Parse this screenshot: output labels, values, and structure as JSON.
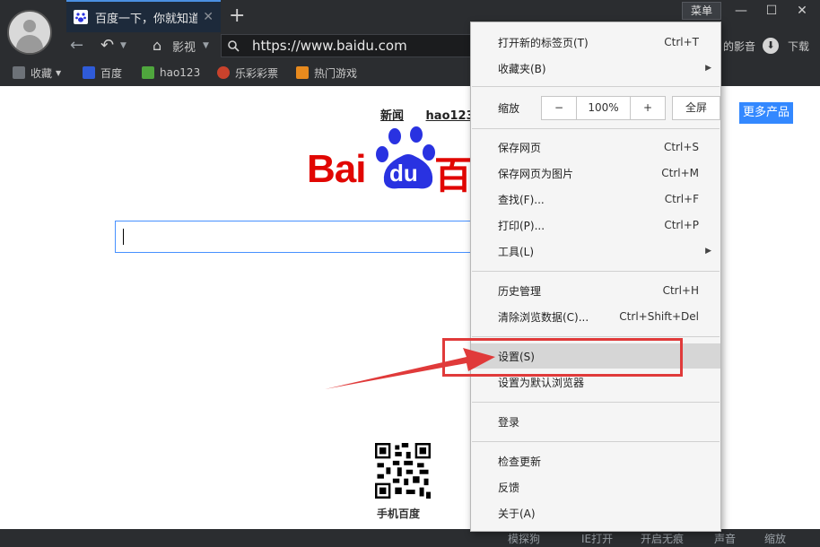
{
  "tab": {
    "title": "百度一下，你就知道",
    "close": "✕"
  },
  "new_tab": "+",
  "window": {
    "menu_label": "菜单",
    "minimize": "—",
    "maximize": "☐",
    "close": "✕"
  },
  "nav": {
    "home_label": "影视",
    "url": "https://www.baidu.com",
    "right_partial": "的影音",
    "download": "下载"
  },
  "bookmarks": [
    {
      "label": "收藏",
      "icon": "star-icon"
    },
    {
      "label": "百度",
      "icon": "baidu-icon"
    },
    {
      "label": "hao123",
      "icon": "hao123-icon"
    },
    {
      "label": "乐彩彩票",
      "icon": "lottery-icon"
    },
    {
      "label": "热门游戏",
      "icon": "game-icon"
    }
  ],
  "page": {
    "toplinks": [
      "新闻",
      "hao123"
    ],
    "more_products": "更多产品",
    "logo_text_left": "Bai",
    "logo_text_du": "du",
    "logo_text_right": "百",
    "qr_label": "手机百度"
  },
  "menu": {
    "items_group1": [
      {
        "label": "打开新的标签页(T)",
        "shortcut": "Ctrl+T",
        "submenu": false
      },
      {
        "label": "收藏夹(B)",
        "shortcut": "",
        "submenu": true
      }
    ],
    "zoom": {
      "label": "缩放",
      "minus": "−",
      "value": "100%",
      "plus": "+",
      "fullscreen": "全屏"
    },
    "items_group2": [
      {
        "label": "保存网页",
        "shortcut": "Ctrl+S",
        "submenu": false
      },
      {
        "label": "保存网页为图片",
        "shortcut": "Ctrl+M",
        "submenu": false
      },
      {
        "label": "查找(F)...",
        "shortcut": "Ctrl+F",
        "submenu": false
      },
      {
        "label": "打印(P)...",
        "shortcut": "Ctrl+P",
        "submenu": false
      },
      {
        "label": "工具(L)",
        "shortcut": "",
        "submenu": true
      }
    ],
    "items_group3": [
      {
        "label": "历史管理",
        "shortcut": "Ctrl+H"
      },
      {
        "label": "清除浏览数据(C)...",
        "shortcut": "Ctrl+Shift+Del"
      }
    ],
    "items_group4": [
      {
        "label": "设置(S)",
        "shortcut": ""
      },
      {
        "label": "设置为默认浏览器",
        "shortcut": ""
      }
    ],
    "items_group5": [
      {
        "label": "登录"
      }
    ],
    "items_group6": [
      {
        "label": "检查更新"
      },
      {
        "label": "反馈"
      },
      {
        "label": "关于(A)"
      }
    ],
    "submenu_arrow": "▶"
  },
  "statusbar": {
    "items": [
      "模探狗",
      "IE打开",
      "开启无痕",
      "声音",
      "缩放"
    ]
  },
  "colors": {
    "accent": "#3388ff",
    "highlight_box": "#e03a3a",
    "chrome_bg": "#2b2d30"
  }
}
